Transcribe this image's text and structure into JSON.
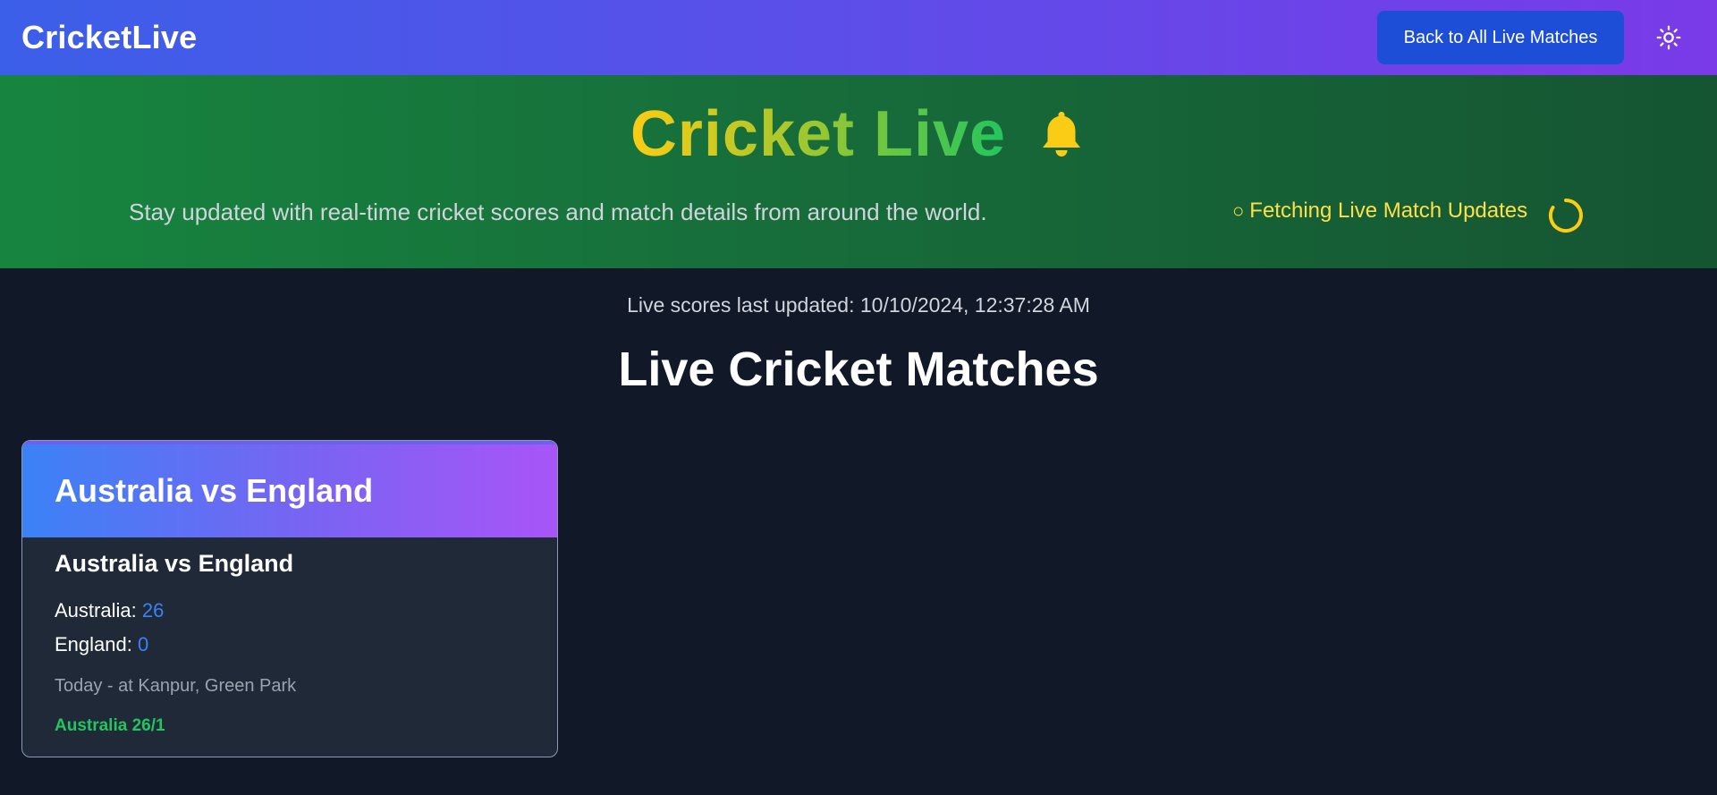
{
  "navbar": {
    "brand": "CricketLive",
    "back_button_label": "Back to All Live Matches",
    "theme_toggle_icon": "sun-icon"
  },
  "hero": {
    "title": "Cricket Live",
    "title_icon": "bell-icon",
    "subtitle": "Stay updated with real-time cricket scores and match details from around the world.",
    "fetch_status_icon": "○",
    "fetch_status": "Fetching Live Match Updates",
    "spinner_icon": "spinner-icon"
  },
  "main": {
    "last_updated": "Live scores last updated: 10/10/2024, 12:37:28 AM",
    "section_title": "Live Cricket Matches",
    "matches": [
      {
        "header_title": "Australia vs England",
        "title": "Australia vs England",
        "team1": {
          "label": "Australia:",
          "score": "26"
        },
        "team2": {
          "label": "England:",
          "score": "0"
        },
        "info": "Today - at Kanpur, Green Park",
        "status": "Australia 26/1"
      }
    ]
  },
  "colors": {
    "navbar_gradient_start": "#3b5fe8",
    "navbar_gradient_end": "#7a3ae8",
    "back_button": "#1d4ed8",
    "hero_gradient_start": "#17853f",
    "hero_gradient_end": "#155532",
    "title_gradient_start": "#facc15",
    "title_gradient_end": "#22c55e",
    "bell": "#facc15",
    "fetch_status": "#fde047",
    "page_background": "#111827",
    "card_background": "#1f2937",
    "card_header_start": "#3b82f6",
    "card_header_end": "#a855f7",
    "score": "#3b82f6",
    "status": "#22c55e"
  }
}
